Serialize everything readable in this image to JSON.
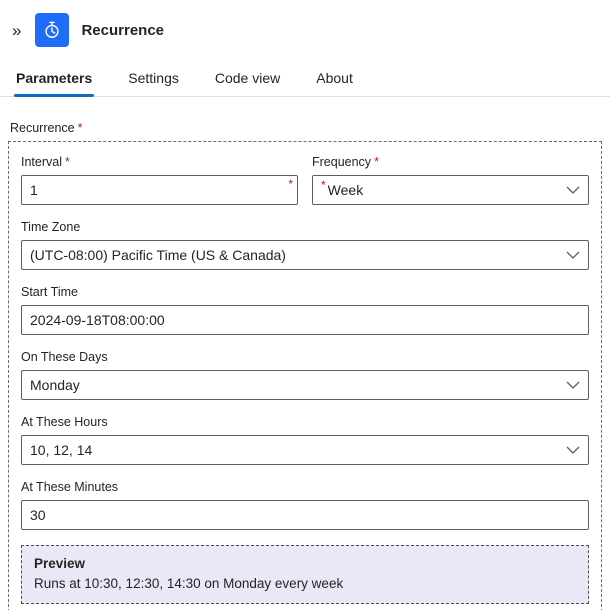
{
  "header": {
    "title": "Recurrence",
    "collapse_glyph": "»"
  },
  "tabs": [
    {
      "label": "Parameters",
      "active": true
    },
    {
      "label": "Settings",
      "active": false
    },
    {
      "label": "Code view",
      "active": false
    },
    {
      "label": "About",
      "active": false
    }
  ],
  "section": {
    "label": "Recurrence",
    "required_marker": "*"
  },
  "fields": {
    "interval": {
      "label": "Interval",
      "required_marker": "*",
      "value": "1"
    },
    "frequency": {
      "label": "Frequency",
      "required_marker": "*",
      "value": "Week"
    },
    "timezone": {
      "label": "Time Zone",
      "value": "(UTC-08:00) Pacific Time (US & Canada)"
    },
    "start_time": {
      "label": "Start Time",
      "value": "2024-09-18T08:00:00"
    },
    "days": {
      "label": "On These Days",
      "value": "Monday"
    },
    "hours": {
      "label": "At These Hours",
      "value": "10, 12, 14"
    },
    "minutes": {
      "label": "At These Minutes",
      "value": "30"
    }
  },
  "preview": {
    "title": "Preview",
    "text": "Runs at 10:30, 12:30, 14:30 on Monday every week"
  },
  "colors": {
    "icon_bg": "#1f6cf9",
    "tab_accent": "#0f6cbd",
    "required": "#a4262c",
    "preview_bg": "#e9e8f7"
  }
}
